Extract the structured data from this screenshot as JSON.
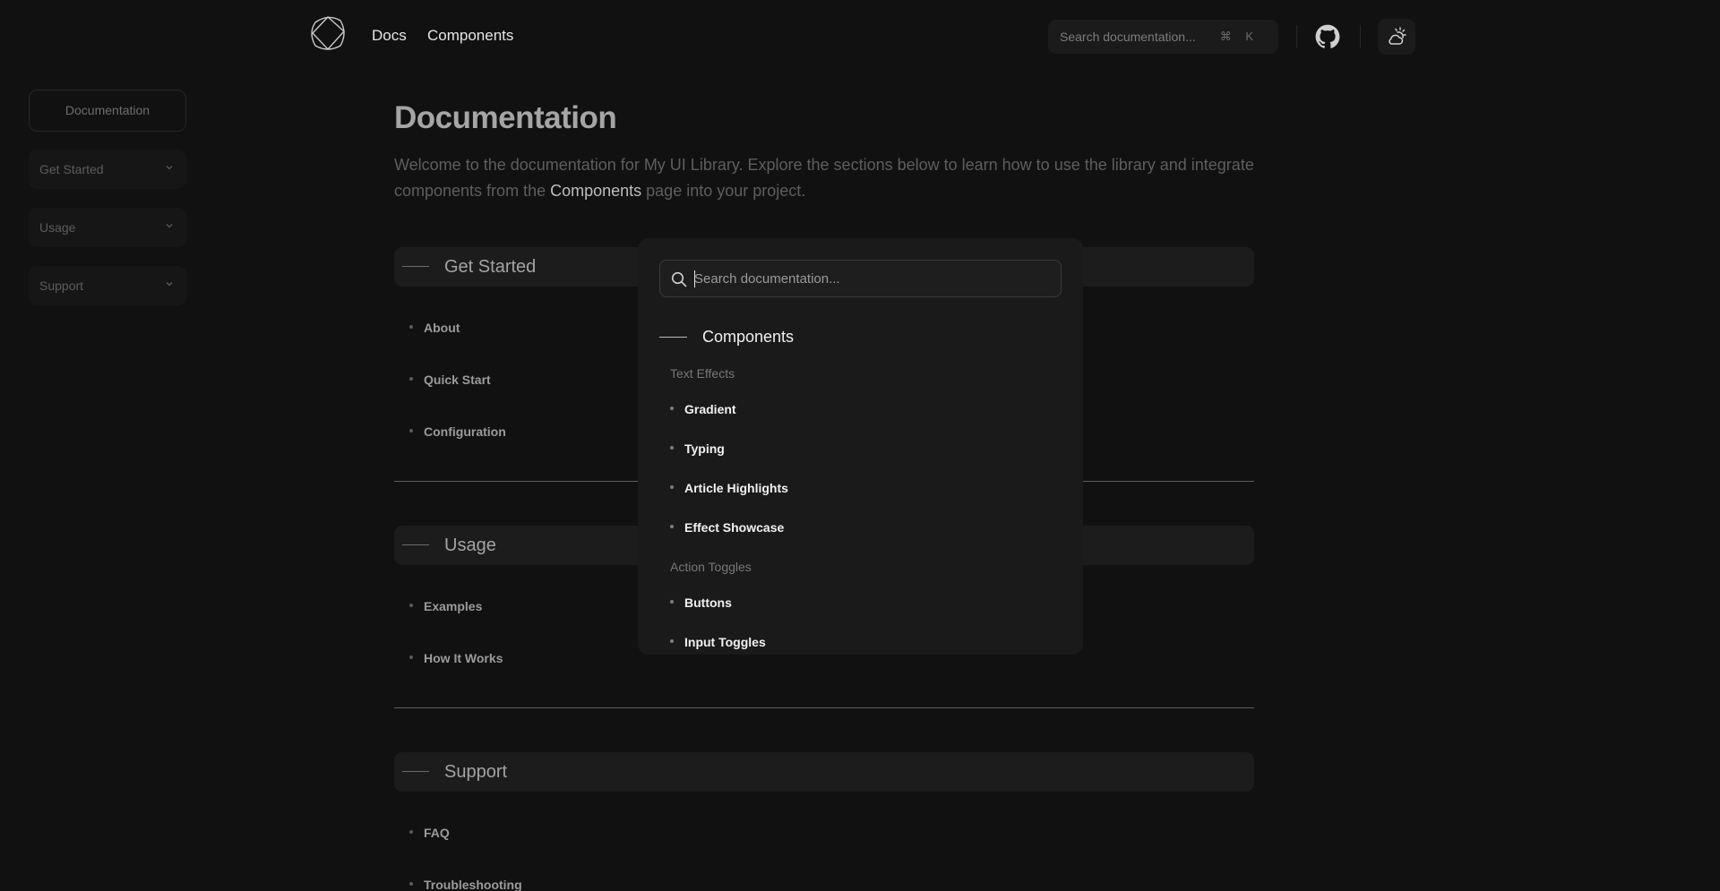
{
  "header": {
    "nav": [
      {
        "label": "Docs"
      },
      {
        "label": "Components"
      }
    ],
    "search": {
      "placeholder": "Search documentation...",
      "shortcut": "⌘ K"
    },
    "icons": {
      "logo": "logo-mark-icon",
      "github": "github-icon",
      "theme": "sun-cloud-icon"
    }
  },
  "sidebar": {
    "top_label": "Documentation",
    "items": [
      {
        "label": "Get Started",
        "icon": "chevron-down-icon"
      },
      {
        "label": "Usage",
        "icon": "chevron-down-icon"
      },
      {
        "label": "Support",
        "icon": "chevron-down-icon"
      }
    ]
  },
  "main": {
    "title": "Documentation",
    "intro_before": "Welcome to the documentation for My UI Library. Explore the sections below to learn how to use the library and integrate components from the ",
    "intro_link": "Components",
    "intro_after": " page into your project.",
    "sections": [
      {
        "title": "Get Started",
        "items": [
          "About",
          "Quick Start",
          "Configuration"
        ]
      },
      {
        "title": "Usage",
        "items": [
          "Examples",
          "How It Works"
        ]
      },
      {
        "title": "Support",
        "items": [
          "FAQ",
          "Troubleshooting"
        ]
      }
    ]
  },
  "modal": {
    "search_placeholder": "Search documentation...",
    "group_title": "Components",
    "categories": [
      {
        "label": "Text Effects",
        "items": [
          "Gradient",
          "Typing",
          "Article Highlights",
          "Effect Showcase"
        ]
      },
      {
        "label": "Action Toggles",
        "items": [
          "Buttons",
          "Input Toggles"
        ]
      }
    ]
  },
  "colors": {
    "background": "#111111",
    "panel": "#1a1a1a",
    "section_bar": "#1c1c1c",
    "text_strong": "#f2f2f2",
    "text_muted": "#5e5e5e"
  }
}
